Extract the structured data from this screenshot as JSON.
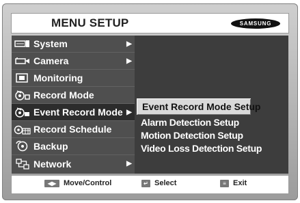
{
  "header": {
    "title": "MENU SETUP",
    "logo_text": "SAMSUNG"
  },
  "sidebar": {
    "items": [
      {
        "label": "System",
        "icon": "keyboard-key-icon",
        "has_submenu": true
      },
      {
        "label": "Camera",
        "icon": "camera-icon",
        "has_submenu": true
      },
      {
        "label": "Monitoring",
        "icon": "monitor-icon",
        "has_submenu": false
      },
      {
        "label": "Record Mode",
        "icon": "record-mode-icon",
        "has_submenu": false
      },
      {
        "label": "Event Record Mode",
        "icon": "event-record-icon",
        "has_submenu": true,
        "active": true
      },
      {
        "label": "Record Schedule",
        "icon": "record-schedule-icon",
        "has_submenu": false
      },
      {
        "label": "Backup",
        "icon": "backup-icon",
        "has_submenu": false
      },
      {
        "label": "Network",
        "icon": "network-icon",
        "has_submenu": true
      }
    ],
    "arrow_glyph": "▶"
  },
  "submenu": {
    "selected": "Event Record Mode Setup",
    "items": [
      "Alarm Detection Setup",
      "Motion Detection Setup",
      "Video Loss Detection Setup"
    ]
  },
  "footer": {
    "move_label": "Move/Control",
    "select_label": "Select",
    "exit_label": "Exit"
  },
  "colors": {
    "panel": "#3d3d3d",
    "sidebar": "#4f4f4f",
    "active_item": "#2c2c2c",
    "highlight": "#d9d9d9"
  }
}
